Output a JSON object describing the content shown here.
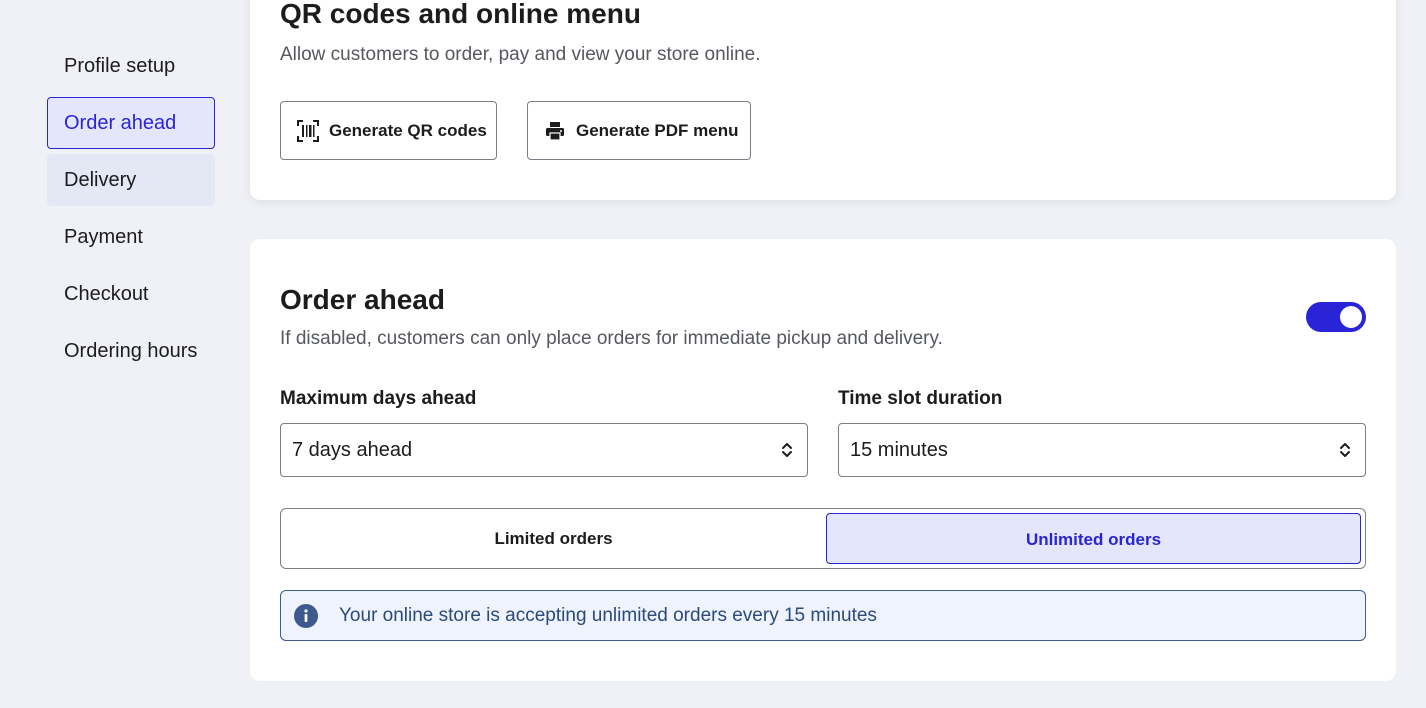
{
  "sidebar": {
    "items": [
      {
        "label": "Profile setup"
      },
      {
        "label": "Order ahead"
      },
      {
        "label": "Delivery"
      },
      {
        "label": "Payment"
      },
      {
        "label": "Checkout"
      },
      {
        "label": "Ordering hours"
      }
    ],
    "active_item": "Order ahead"
  },
  "qr_card": {
    "title": "QR codes and online menu",
    "subtitle": "Allow customers to order, pay and view your store online.",
    "generate_qr_label": "Generate QR codes",
    "generate_pdf_label": "Generate PDF menu"
  },
  "order_ahead": {
    "title": "Order ahead",
    "subtitle": "If disabled, customers can only place orders for immediate pickup and delivery.",
    "enabled": true,
    "max_days": {
      "label": "Maximum days ahead",
      "value": "7 days ahead"
    },
    "slot_duration": {
      "label": "Time slot duration",
      "value": "15 minutes"
    },
    "order_modes": {
      "options": [
        "Limited orders",
        "Unlimited orders"
      ],
      "selected": "Unlimited orders"
    },
    "info_text": "Your online store is accepting unlimited orders every 15 minutes"
  },
  "colors": {
    "accent": "#2a24d9",
    "accent_bg": "#e4e7fb",
    "page_bg": "#eff1f6",
    "info_border": "#3d5a8c",
    "info_bg": "#eef3fd"
  },
  "icons": {
    "qr": "qr-code-scan-icon",
    "pdf": "printer-icon",
    "info": "info-circle-icon",
    "select": "chevron-up-down-icon"
  }
}
